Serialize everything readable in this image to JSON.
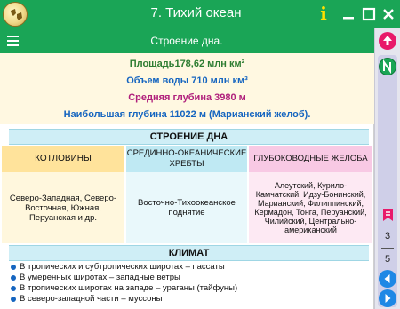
{
  "window": {
    "title": "7. Тихий океан",
    "info_label": "i"
  },
  "toolbar": {
    "section_title": "Строение дна."
  },
  "stats": {
    "area": "Площадь178,62 млн км²",
    "volume": "Объем воды 710 млн км³",
    "avg_depth": "Средняя глубина 3980 м",
    "max_depth": "Наибольшая глубина 11022 м (Марианский желоб)."
  },
  "relief": {
    "heading": "СТРОЕНИЕ ДНА",
    "columns": [
      {
        "title": "КОТЛОВИНЫ",
        "body": "Северо-Западная, Северо-Восточная, Южная, Перуанская и др."
      },
      {
        "title": "СРЕДИННО-ОКЕАНИЧЕСКИЕ ХРЕБТЫ",
        "body": "Восточно-Тихоокеанское поднятие"
      },
      {
        "title": "ГЛУБОКОВОДНЫЕ ЖЕЛОБА",
        "body": "Алеутский, Курило-Камчатский, Идзу-Бонинский, Марианский, Филиппинский, Кермадон, Тонга, Перуанский, Чилийский, Центрально-американский"
      }
    ]
  },
  "climate": {
    "heading": "КЛИМАТ",
    "items": [
      "В тропических и субтропических широтах – пассаты",
      "В умеренных широтах – западные ветры",
      "В тропических широтах на западе – ураганы (тайфуны)",
      "В северо-западной части – муссоны"
    ]
  },
  "pager": {
    "current": "3",
    "total": "5"
  },
  "colors": {
    "accent": "#1aa556",
    "pink": "#e8196a",
    "blue": "#1e88e5"
  },
  "icons": [
    "app-globe-icon",
    "info-icon",
    "minimize-icon",
    "maximize-icon",
    "close-icon",
    "menu-icon",
    "scroll-top-icon",
    "notes-icon",
    "bookmark-icon",
    "prev-icon",
    "next-icon"
  ]
}
